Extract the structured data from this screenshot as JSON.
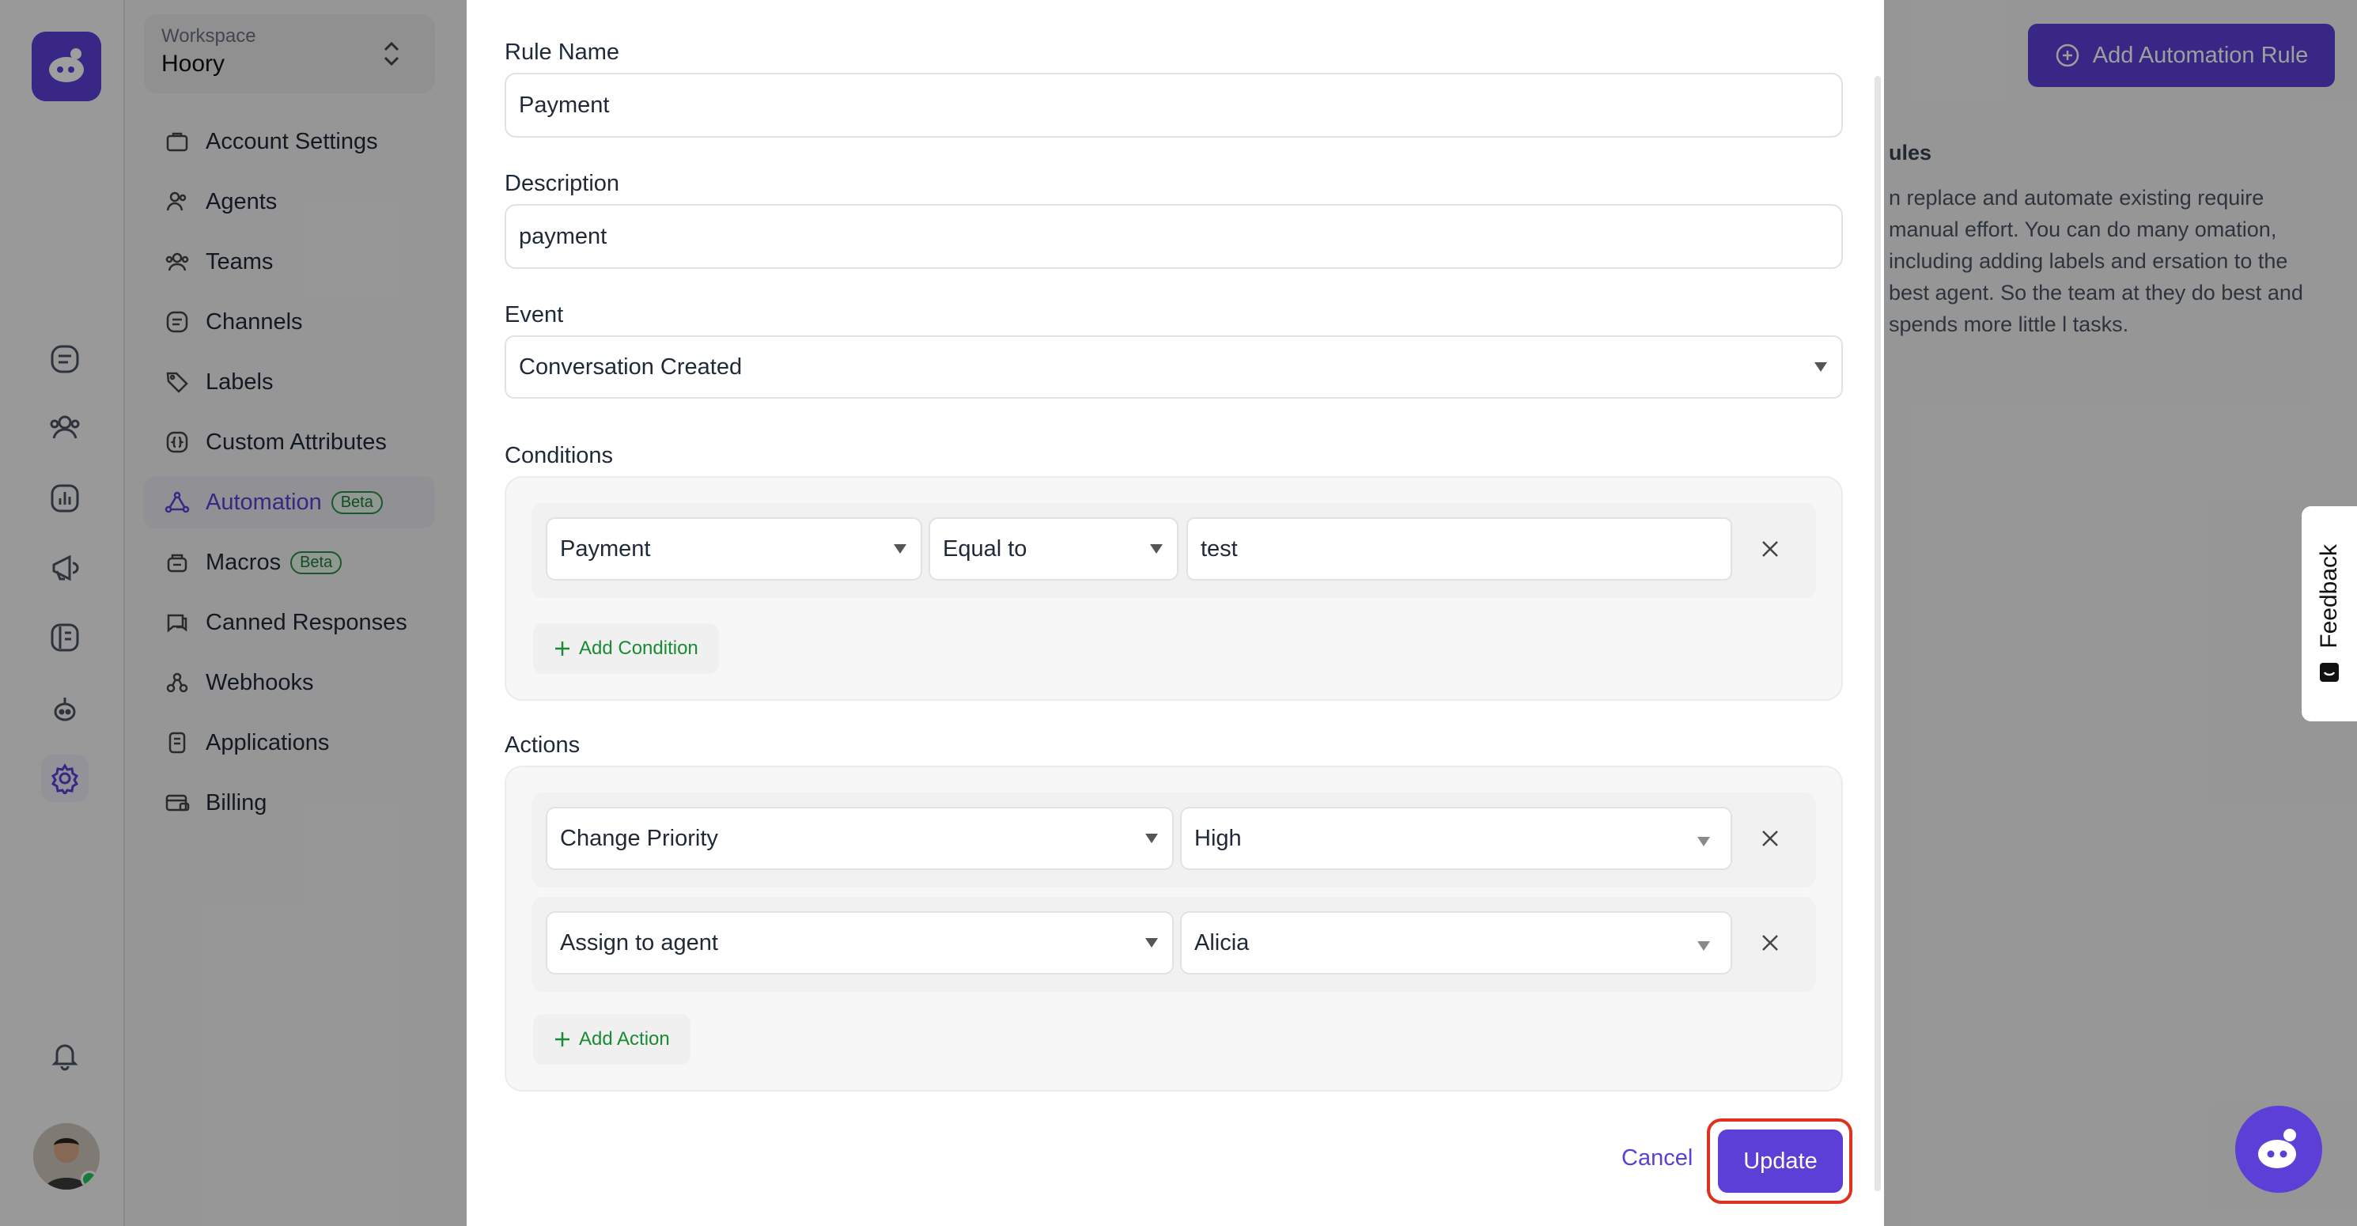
{
  "workspace": {
    "label": "Workspace",
    "name": "Hoory"
  },
  "settings_nav": {
    "items": [
      {
        "label": "Account Settings"
      },
      {
        "label": "Agents"
      },
      {
        "label": "Teams"
      },
      {
        "label": "Channels"
      },
      {
        "label": "Labels"
      },
      {
        "label": "Custom Attributes"
      },
      {
        "label": "Automation",
        "badge": "Beta"
      },
      {
        "label": "Macros",
        "badge": "Beta"
      },
      {
        "label": "Canned Responses"
      },
      {
        "label": "Webhooks"
      },
      {
        "label": "Applications"
      },
      {
        "label": "Billing"
      }
    ]
  },
  "header": {
    "add_rule_label": "Add Automation Rule"
  },
  "help": {
    "title": "ules",
    "text": "n replace and automate existing require manual effort. You can do many omation, including adding labels and ersation to the best agent. So the team at they do best and spends more little l tasks."
  },
  "feedback": {
    "label": "Feedback"
  },
  "form": {
    "rule_name": {
      "label": "Rule Name",
      "value": "Payment"
    },
    "description": {
      "label": "Description",
      "value": "payment"
    },
    "event": {
      "label": "Event",
      "value": "Conversation Created"
    },
    "conditions": {
      "label": "Conditions",
      "rows": [
        {
          "attribute": "Payment",
          "operator": "Equal to",
          "value": "test"
        }
      ],
      "add_label": "Add Condition"
    },
    "actions": {
      "label": "Actions",
      "rows": [
        {
          "action": "Change Priority",
          "value": "High"
        },
        {
          "action": "Assign to agent",
          "value": "Alicia"
        }
      ],
      "add_label": "Add Action"
    },
    "cancel_label": "Cancel",
    "update_label": "Update"
  },
  "colors": {
    "accent": "#5b3fd6",
    "highlight": "#e0301e",
    "add_link": "#1a8a33"
  }
}
